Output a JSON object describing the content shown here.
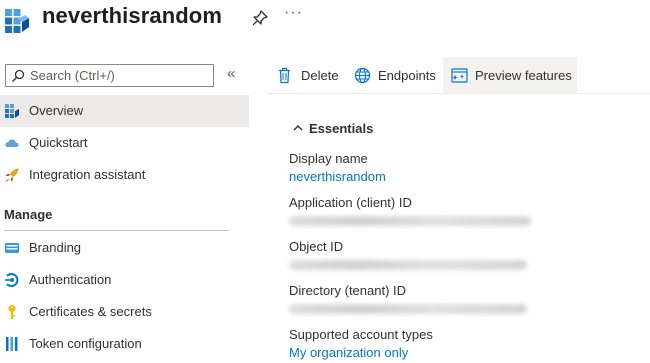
{
  "header": {
    "title": "neverthisrandom",
    "more_label": "···",
    "icon": "app-registration-icon"
  },
  "sidebar": {
    "search_placeholder": "Search (Ctrl+/)",
    "collapse_label": "«",
    "items": [
      {
        "label": "Overview",
        "icon": "overview-grid-icon",
        "active": true
      },
      {
        "label": "Quickstart",
        "icon": "cloud-icon"
      },
      {
        "label": "Integration assistant",
        "icon": "rocket-icon"
      }
    ],
    "manage_heading": "Manage",
    "manage_items": [
      {
        "label": "Branding",
        "icon": "branding-icon"
      },
      {
        "label": "Authentication",
        "icon": "authentication-icon"
      },
      {
        "label": "Certificates & secrets",
        "icon": "key-icon"
      },
      {
        "label": "Token configuration",
        "icon": "token-bars-icon"
      }
    ]
  },
  "toolbar": {
    "delete_label": "Delete",
    "endpoints_label": "Endpoints",
    "preview_label": "Preview features"
  },
  "essentials": {
    "heading": "Essentials",
    "fields": [
      {
        "label": "Display name",
        "value": "neverthisrandom"
      },
      {
        "label": "Application (client) ID"
      },
      {
        "label": "Object ID"
      },
      {
        "label": "Directory (tenant) ID"
      },
      {
        "label": "Supported account types",
        "value": "My organization only"
      }
    ]
  },
  "colors": {
    "accent": "#0078d4",
    "active_bg": "#edebe9",
    "toolbar_hover_bg": "#f3f2f1"
  }
}
